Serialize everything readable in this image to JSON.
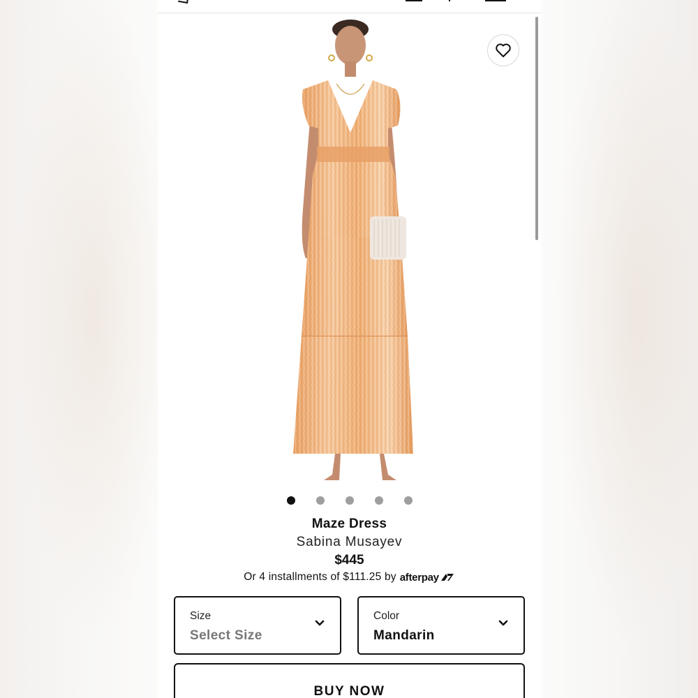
{
  "product": {
    "name": "Maze Dress",
    "brand": "Sabina Musayev",
    "price": "$445",
    "installments_text": "Or 4 installments of $111.25 by",
    "afterpay_label": "afterpay"
  },
  "gallery": {
    "image_count": 5,
    "active_index": 0,
    "dress_color": "#f2b67a"
  },
  "size_select": {
    "label": "Size",
    "value": "Select Size"
  },
  "color_select": {
    "label": "Color",
    "value": "Mandarin"
  },
  "buy_button": {
    "label": "BUY NOW"
  },
  "icons": {
    "wishlist": "heart-icon",
    "chevron": "chevron-down-icon"
  }
}
